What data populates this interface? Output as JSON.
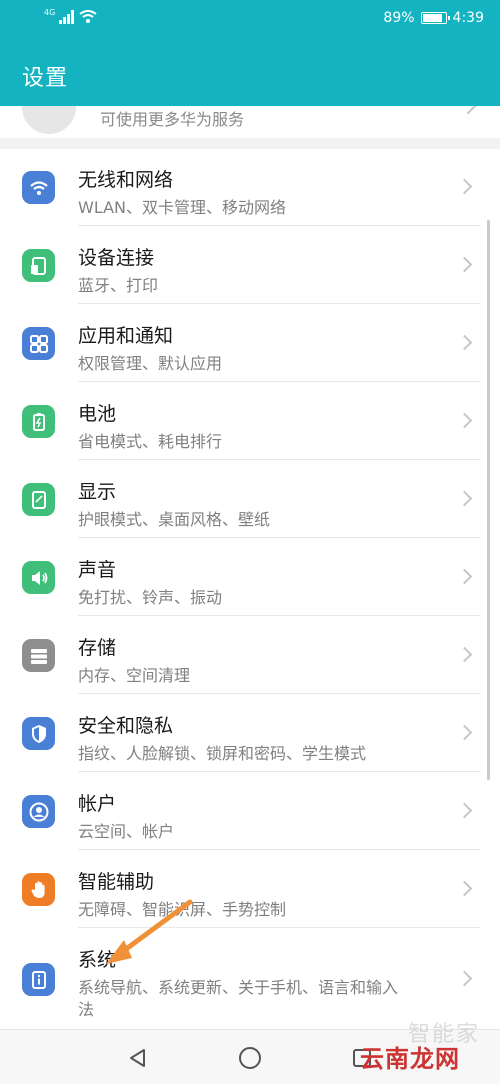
{
  "status_bar": {
    "network": "4G",
    "battery_percent": "89%",
    "battery_level": 0.89,
    "time": "4:39"
  },
  "header": {
    "title": "设置"
  },
  "account": {
    "subtitle": "可使用更多华为服务"
  },
  "settings": [
    {
      "title": "无线和网络",
      "subtitle": "WLAN、双卡管理、移动网络",
      "icon": "wifi-icon",
      "color": "#4a7fd6"
    },
    {
      "title": "设备连接",
      "subtitle": "蓝牙、打印",
      "icon": "device-connection-icon",
      "color": "#3fbf7a"
    },
    {
      "title": "应用和通知",
      "subtitle": "权限管理、默认应用",
      "icon": "apps-icon",
      "color": "#4a7fd6"
    },
    {
      "title": "电池",
      "subtitle": "省电模式、耗电排行",
      "icon": "battery-icon",
      "color": "#3fbf7a"
    },
    {
      "title": "显示",
      "subtitle": "护眼模式、桌面风格、壁纸",
      "icon": "display-icon",
      "color": "#3fbf7a"
    },
    {
      "title": "声音",
      "subtitle": "免打扰、铃声、振动",
      "icon": "sound-icon",
      "color": "#3fbf7a"
    },
    {
      "title": "存储",
      "subtitle": "内存、空间清理",
      "icon": "storage-icon",
      "color": "#8e8e8e"
    },
    {
      "title": "安全和隐私",
      "subtitle": "指纹、人脸解锁、锁屏和密码、学生模式",
      "icon": "shield-icon",
      "color": "#4a7fd6"
    },
    {
      "title": "帐户",
      "subtitle": "云空间、帐户",
      "icon": "account-icon",
      "color": "#4a7fd6"
    },
    {
      "title": "智能辅助",
      "subtitle": "无障碍、智能识屏、手势控制",
      "icon": "hand-icon",
      "color": "#ef7d25"
    },
    {
      "title": "系统",
      "subtitle": "系统导航、系统更新、关于手机、语言和输入",
      "subtitle2": "法",
      "icon": "system-info-icon",
      "color": "#4a7fd6"
    }
  ],
  "watermark": {
    "text": "云南龙网",
    "faint_text": "智能家"
  },
  "colors": {
    "accent": "#14b3c2",
    "arrow": "#f0913a"
  }
}
